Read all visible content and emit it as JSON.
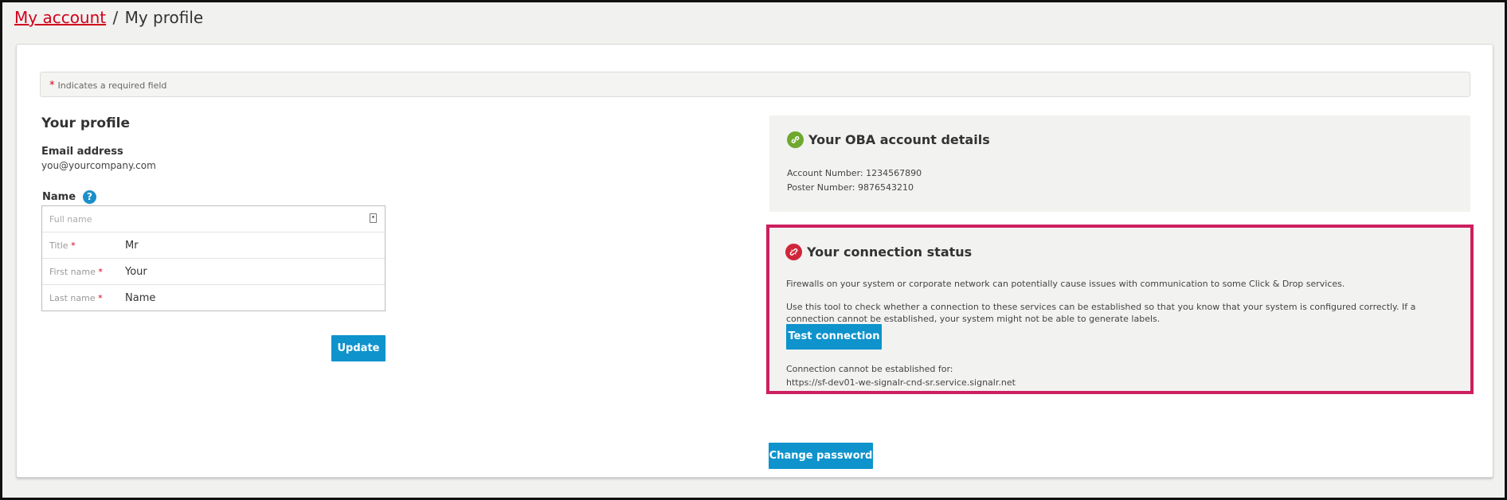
{
  "breadcrumb": {
    "parent": "My account",
    "separator": "/",
    "current": "My profile"
  },
  "required_note": {
    "star": "*",
    "text": "Indicates a required field"
  },
  "profile": {
    "heading": "Your profile",
    "email_label": "Email address",
    "email_value": "you@yourcompany.com",
    "name_label": "Name",
    "help_glyph": "?",
    "full_name_placeholder": "Full name",
    "title_label": "Title",
    "title_value": "Mr",
    "first_name_label": "First name",
    "first_name_value": "Your",
    "last_name_label": "Last name",
    "last_name_value": "Name",
    "required_star": "*",
    "update_button": "Update"
  },
  "oba": {
    "title": "Your OBA account details",
    "account_number": "Account Number: 1234567890",
    "poster_number": "Poster Number: 9876543210",
    "icon": "link-icon",
    "icon_color": "#6ea82e"
  },
  "connection": {
    "title": "Your connection status",
    "icon": "broken-link-icon",
    "icon_color": "#d0263a",
    "border_color": "#cc1f5f",
    "para1": "Firewalls on your system or corporate network can potentially cause issues with communication to some Click & Drop services.",
    "para2": "Use this tool to check whether a connection to these services can be established so that you know that your system is configured correctly. If a connection cannot be established, your system might not be able to generate labels.",
    "test_button": "Test connection",
    "fail_label": "Connection cannot be established for:",
    "fail_url": "https://sf-dev01-we-signalr-cnd-sr.service.signalr.net"
  },
  "change_password_button": "Change password",
  "colors": {
    "accent_blue": "#0e93cc",
    "link_red": "#d0021b"
  }
}
